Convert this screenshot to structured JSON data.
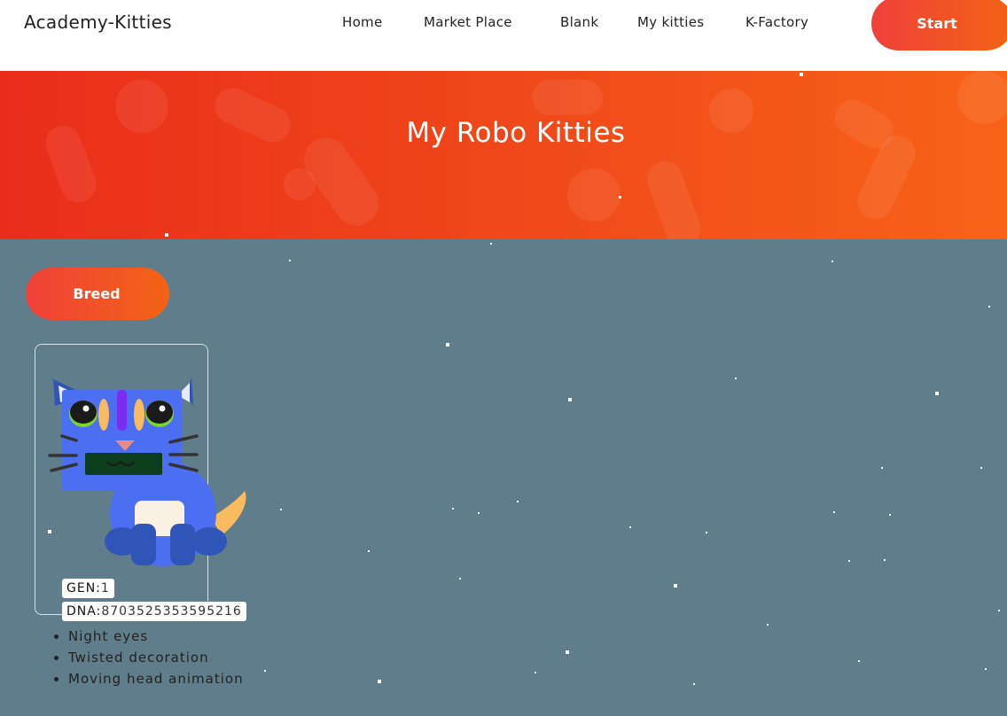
{
  "navbar": {
    "brand": "Academy-Kitties",
    "items": [
      {
        "label": "Home"
      },
      {
        "label": "Market Place"
      },
      {
        "label": "Blank"
      },
      {
        "label": "My kitties"
      },
      {
        "label": "K-Factory"
      }
    ],
    "start_label": "Start"
  },
  "hero": {
    "title": "My Robo Kitties"
  },
  "breed_label": "Breed",
  "kitty": {
    "gen_label": "GEN:",
    "gen": "1",
    "dna_label": "DNA:",
    "dna": "8703525353595216",
    "attributes": [
      "Night eyes",
      "Twisted decoration",
      "Moving head animation"
    ]
  },
  "colors": {
    "background": "#607d8b",
    "accent_start": "#f0403a",
    "accent_end": "#f26414",
    "kitty_body": "#4c6ef0",
    "kitty_accent": "#f9bb5f",
    "kitty_decoration": "#7a2cf0"
  },
  "icons": [
    "robo-kitty-image"
  ]
}
